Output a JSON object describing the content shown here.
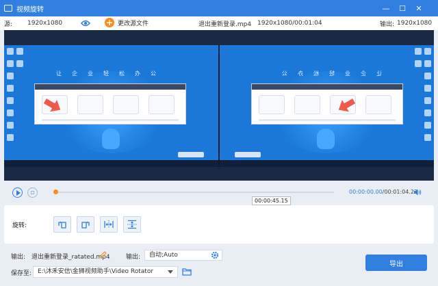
{
  "window": {
    "title": "视频旋转",
    "minimize_glyph": "—",
    "maximize_glyph": "☐",
    "close_glyph": "✕"
  },
  "infobar": {
    "source_label": "源:",
    "source_resolution": "1920x1080",
    "change_source_label": "更改源文件",
    "file_name": "退出重新登录.mp4",
    "file_info": "1920x1080/00:01:04",
    "output_label": "输出:",
    "output_resolution": "1920x1080"
  },
  "preview": {
    "slogan": "让企业轻松办公"
  },
  "player": {
    "current_time": "00:00:00.00",
    "separator": "/",
    "total_time": "00:01:04.23",
    "progress": 0.0,
    "hover_time": "00:00:45.15"
  },
  "rotation": {
    "label": "旋转:",
    "buttons": [
      "rotate-left",
      "rotate-right",
      "flip-horizontal",
      "flip-vertical"
    ]
  },
  "output": {
    "label": "输出:",
    "filename": "退出重新登录_ratated.mp4",
    "format_label": "输出:",
    "format_value": "自动;Auto"
  },
  "save": {
    "label": "保存至:",
    "path": "E:\\沐禾安信\\金狮视频助手\\Video Rotator"
  },
  "export_label": "导出",
  "colors": {
    "accent": "#2f7ee0",
    "orange": "#ff8a1c",
    "preview_bg": "#1b78d8"
  }
}
